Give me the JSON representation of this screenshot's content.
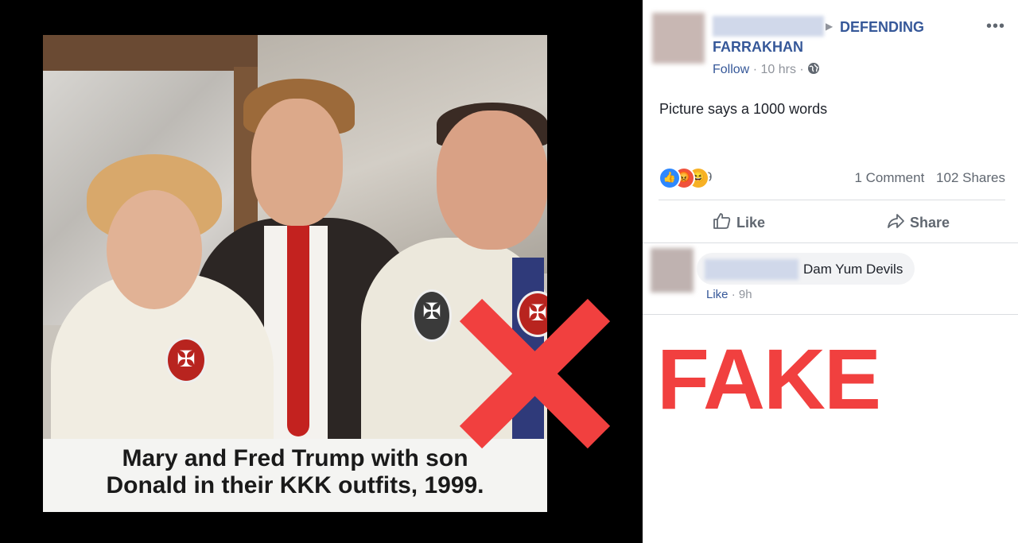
{
  "photo": {
    "caption_line1": "Mary and Fred Trump with son",
    "caption_line2": "Donald in their KKK outfits, 1999."
  },
  "post": {
    "group_name_line1": "DEFENDING",
    "group_name_line2": "FARRAKHAN",
    "follow": "Follow",
    "separator": "·",
    "time": "10 hrs",
    "text": "Picture says a 1000 words",
    "reaction_count": "9",
    "comments": "1 Comment",
    "shares": "102 Shares",
    "like_label": "Like",
    "share_label": "Share",
    "more_glyph": "•••"
  },
  "comment": {
    "text": "Dam Yum Devils",
    "like": "Like",
    "time": "9h"
  },
  "verdict": {
    "label": "FAKE",
    "color": "#f1403f"
  },
  "colors": {
    "fb_link": "#365899",
    "background": "#000000"
  }
}
